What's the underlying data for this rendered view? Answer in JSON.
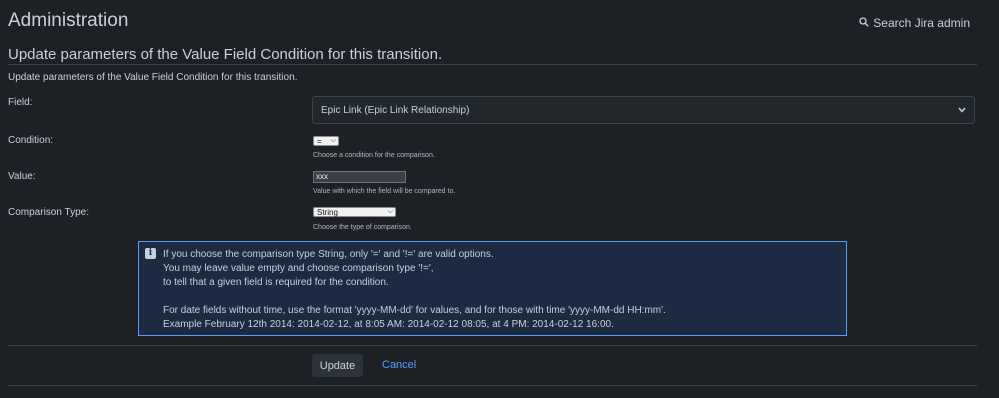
{
  "header": {
    "title": "Administration",
    "search_label": "Search Jira admin"
  },
  "form": {
    "heading": "Update parameters of the Value Field Condition for this transition.",
    "description": "Update parameters of the Value Field Condition for this transition.",
    "field": {
      "label": "Field:",
      "selected": "Epic Link (Epic Link Relationship)"
    },
    "condition": {
      "label": "Condition:",
      "selected": "=",
      "helper": "Choose a condition for the comparison."
    },
    "value": {
      "label": "Value:",
      "input_value": "xxx",
      "helper": "Value with which the field will be compared to."
    },
    "comparison_type": {
      "label": "Comparison Type:",
      "selected": "String",
      "helper": "Choose the type of comparison."
    },
    "info": {
      "lines": [
        "If you choose the comparison type String, only '=' and '!=' are valid options.",
        "You may leave value empty and choose comparison type '!=',",
        "to tell that a given field is required for the condition.",
        "For date fields without time, use the format 'yyyy-MM-dd' for values, and for those with time 'yyyy-MM-dd HH:mm'.",
        "Example February 12th 2014: 2014-02-12, at 8:05 AM: 2014-02-12 08:05, at 4 PM: 2014-02-12 16:00."
      ]
    },
    "buttons": {
      "update": "Update",
      "cancel": "Cancel"
    }
  }
}
